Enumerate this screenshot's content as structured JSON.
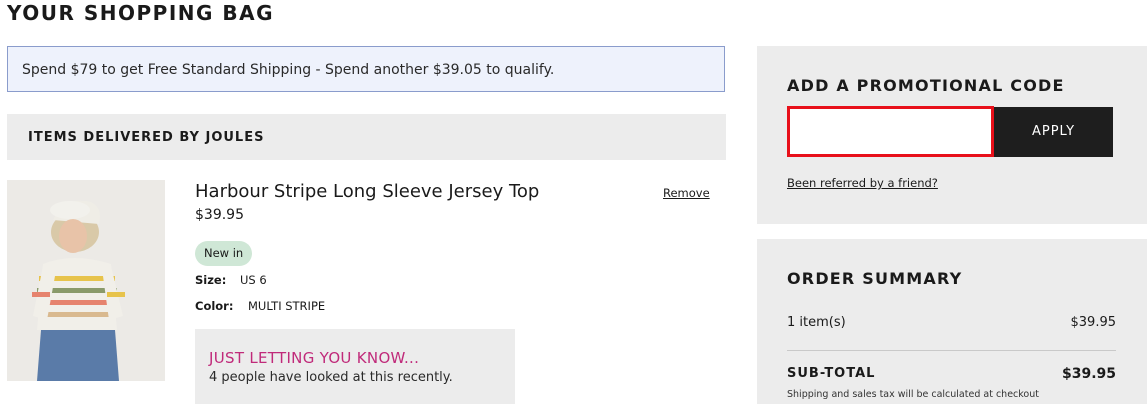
{
  "page": {
    "title": "YOUR SHOPPING BAG"
  },
  "shipping_banner": {
    "text": "Spend $79 to get Free Standard Shipping - Spend another $39.05 to qualify."
  },
  "delivery": {
    "header": "ITEMS DELIVERED BY JOULES"
  },
  "cart_item": {
    "name": "Harbour Stripe Long Sleeve Jersey Top",
    "price": "$39.95",
    "remove_label": "Remove",
    "badge": "New in",
    "size_label": "Size:",
    "size_value": "US 6",
    "color_label": "Color:",
    "color_value": "MULTI STRIPE",
    "notice_title": "JUST LETTING YOU KNOW...",
    "notice_text": "4 people have looked at this recently."
  },
  "promo": {
    "heading": "ADD A PROMOTIONAL CODE",
    "input_value": "",
    "apply_label": "APPLY",
    "referral_link": "Been referred by a friend?"
  },
  "summary": {
    "heading": "ORDER SUMMARY",
    "items_label": "1 item(s)",
    "items_value": "$39.95",
    "subtotal_label": "SUB-TOTAL",
    "subtotal_value": "$39.95",
    "tax_note": "Shipping and sales tax will be calculated at checkout"
  },
  "colors": {
    "banner_border": "#8a9ccc",
    "promo_input_border": "#e8101a",
    "notice_title": "#c02a7a",
    "badge_bg": "#cfe7d6",
    "apply_bg": "#1e1e1e"
  },
  "icons": [
    "product-photo"
  ]
}
